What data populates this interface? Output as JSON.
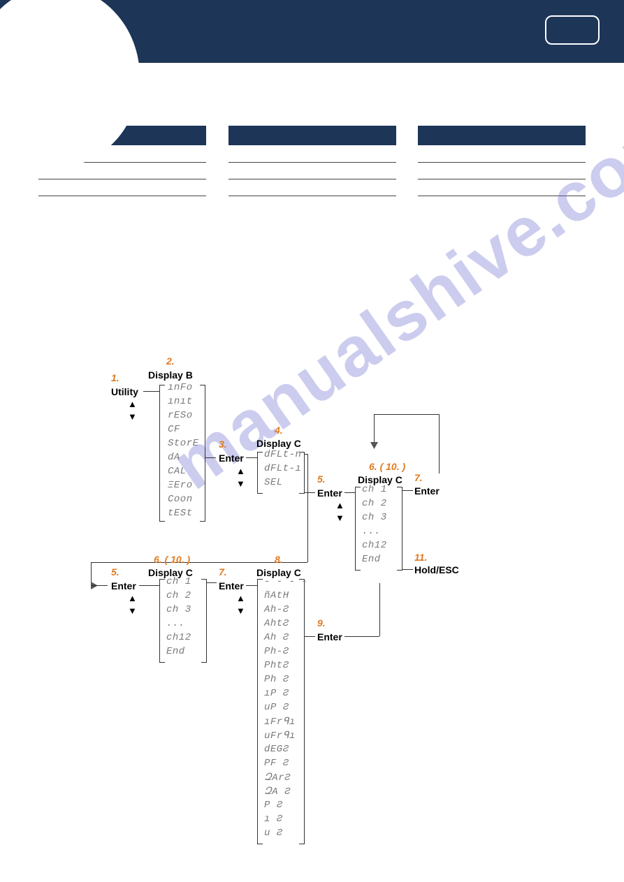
{
  "diagram": {
    "s1": "1.",
    "s2": "2.",
    "s3": "3.",
    "s4": "4.",
    "s5": "5.",
    "s6": "6. ( 10. )",
    "s7": "7.",
    "s8": "8.",
    "s9": "9.",
    "s11": "11.",
    "utility": "Utility",
    "displayB": "Display B",
    "displayC": "Display C",
    "enter": "Enter",
    "holdEsc": "Hold/ESC",
    "up": "▲",
    "down": "▼",
    "menuB": [
      "ınFo",
      "ınıt",
      "rESo",
      "CF",
      "StorE",
      "dA",
      "CAL",
      "ΞEro",
      "Coon",
      "tESt"
    ],
    "menuC1": [
      "dFLt-n",
      "dFLt-ı",
      "SEL"
    ],
    "menuCh": [
      "ch  1",
      "ch  2",
      "ch  3",
      "...",
      "ch12",
      "End"
    ],
    "menuTypes": [
      "- - - -",
      "ñAtH",
      "Ah-Ƨ",
      "AhtƧ",
      "Ah Ƨ",
      "Ph-Ƨ",
      "PhtƧ",
      "Ph Ƨ",
      "ıP Ƨ",
      "uP Ƨ",
      "ıFrᑫı",
      "uFrᑫı",
      "dEGƧ",
      "PF Ƨ",
      "ԶArƧ",
      "ԶA Ƨ",
      "P   Ƨ",
      "ı   Ƨ",
      "u   Ƨ"
    ]
  }
}
